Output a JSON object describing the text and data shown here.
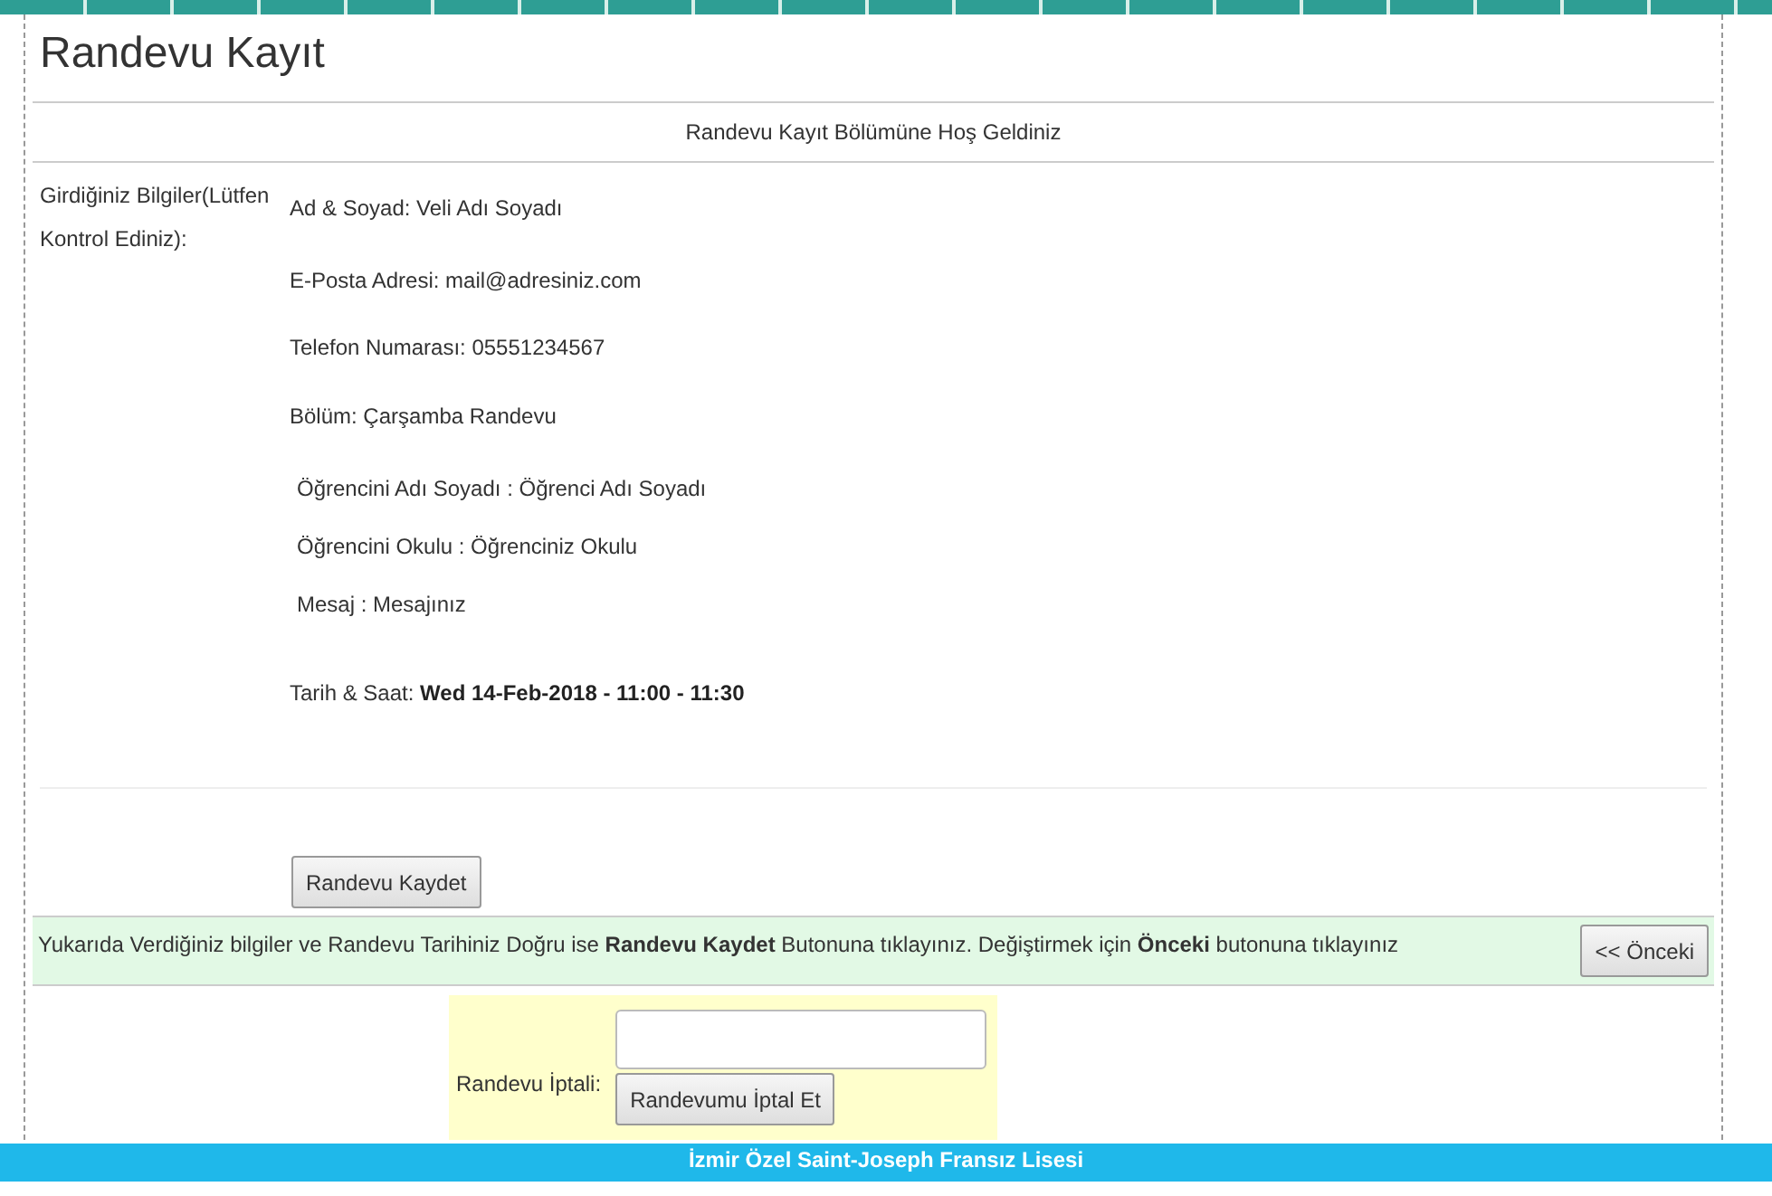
{
  "page": {
    "title": "Randevu Kayıt",
    "welcome": "Randevu Kayıt Bölümüne Hoş Geldiniz"
  },
  "summary": {
    "label": "Girdiğiniz Bilgiler(Lütfen Kontrol Ediniz):",
    "fields": [
      {
        "kind": "plain",
        "text": "Ad & Soyad: Veli Adı Soyadı"
      },
      {
        "kind": "plain",
        "text": "E-Posta Adresi: mail@adresiniz.com"
      },
      {
        "kind": "plain",
        "text": "Telefon Numarası: 05551234567"
      },
      {
        "kind": "plain",
        "text": "Bölüm: Çarşamba Randevu"
      },
      {
        "kind": "indented",
        "text": "Öğrencini Adı Soyadı :  Öğrenci Adı Soyadı"
      },
      {
        "kind": "indented",
        "text": "Öğrencini Okulu :  Öğrenciniz Okulu"
      },
      {
        "kind": "indented",
        "text": "Mesaj :  Mesajınız"
      },
      {
        "kind": "datetime",
        "text": "Tarih & Saat: **Wed 14-Feb-2018 - 11:00 - 11:30**"
      }
    ]
  },
  "save_button": "Randevu Kaydet",
  "notice": {
    "text": "Yukarıda Verdiğiniz bilgiler ve Randevu Tarihiniz Doğru ise **Randevu Kaydet** Butonuna tıklayınız. Değiştirmek için **Önceki** butonuna tıklayınız",
    "back_button": "<< Önceki"
  },
  "cancel": {
    "label": "Randevu İptali:",
    "button": "Randevumu İptal Et"
  },
  "footer": "İzmir Özel Saint-Joseph Fransız Lisesi"
}
